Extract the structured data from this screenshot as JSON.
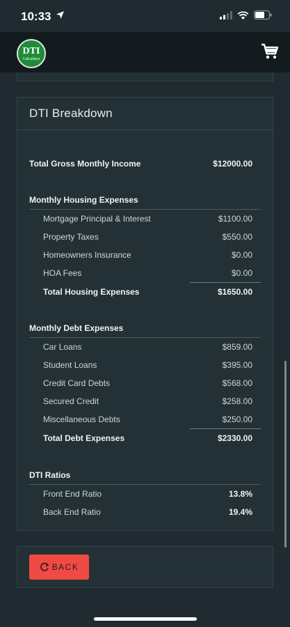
{
  "status_bar": {
    "time": "10:33"
  },
  "header": {
    "logo_main": "DTI",
    "logo_sub": "Calculator"
  },
  "card": {
    "title": "DTI Breakdown",
    "income": {
      "label": "Total Gross Monthly Income",
      "value": "$12000.00"
    },
    "housing": {
      "heading": "Monthly Housing Expenses",
      "items": [
        {
          "label": "Mortgage Principal & Interest",
          "value": "$1100.00"
        },
        {
          "label": "Property Taxes",
          "value": "$550.00"
        },
        {
          "label": "Homeowners Insurance",
          "value": "$0.00"
        },
        {
          "label": "HOA Fees",
          "value": "$0.00"
        }
      ],
      "total_label": "Total Housing Expenses",
      "total_value": "$1650.00"
    },
    "debt": {
      "heading": "Monthly Debt Expenses",
      "items": [
        {
          "label": "Car Loans",
          "value": "$859.00"
        },
        {
          "label": "Student Loans",
          "value": "$395.00"
        },
        {
          "label": "Credit Card Debts",
          "value": "$568.00"
        },
        {
          "label": "Secured Credit",
          "value": "$258.00"
        },
        {
          "label": "Miscellaneous Debts",
          "value": "$250.00"
        }
      ],
      "total_label": "Total Debt Expenses",
      "total_value": "$2330.00"
    },
    "ratios": {
      "heading": "DTI Ratios",
      "items": [
        {
          "label": "Front End Ratio",
          "value": "13.8%"
        },
        {
          "label": "Back End Ratio",
          "value": "19.4%"
        }
      ]
    }
  },
  "back_button": {
    "label": "BACK"
  },
  "colors": {
    "background": "#1f2b30",
    "header": "#141b1e",
    "card": "#233136",
    "logo_green": "#1f8a3a",
    "back_button": "#ef4a44"
  }
}
